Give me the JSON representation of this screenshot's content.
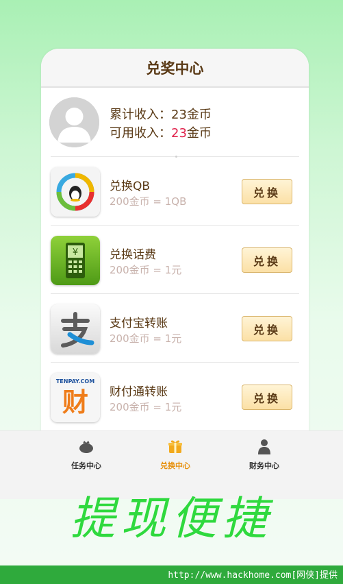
{
  "header": {
    "title": "兑奖中心"
  },
  "profile": {
    "total_label": "累计收入：",
    "total_value": "23金币",
    "available_label": "可用收入：",
    "available_amount": "23",
    "available_unit": "金币"
  },
  "items": [
    {
      "icon": "qq-penguin-icon",
      "title": "兑换QB",
      "rate": "200金币 = 1QB",
      "button": "兑换"
    },
    {
      "icon": "phone-yuan-icon",
      "title": "兑换话费",
      "rate": "200金币 = 1元",
      "button": "兑换"
    },
    {
      "icon": "alipay-icon",
      "title": "支付宝转账",
      "rate": "200金币 = 1元",
      "button": "兑换"
    },
    {
      "icon": "tenpay-icon",
      "title": "财付通转账",
      "rate": "200金币 = 1元",
      "button": "兑换",
      "icon_text_top": "TENPAY.COM",
      "icon_text_main": "财"
    }
  ],
  "tabs": [
    {
      "label": "任务中心",
      "icon": "task-bag-icon",
      "active": false
    },
    {
      "label": "兑换中心",
      "icon": "gift-box-icon",
      "active": true
    },
    {
      "label": "财务中心",
      "icon": "person-icon",
      "active": false
    }
  ],
  "slogan": "提现便捷",
  "footer": {
    "text": "http://www.hackhome.com[网侠]提供"
  },
  "colors": {
    "brand_brown": "#5a3a16",
    "highlight_red": "#e0204a",
    "tab_active": "#e7900c",
    "slogan_green": "#2fd93e",
    "footer_green": "#2faa3c"
  }
}
